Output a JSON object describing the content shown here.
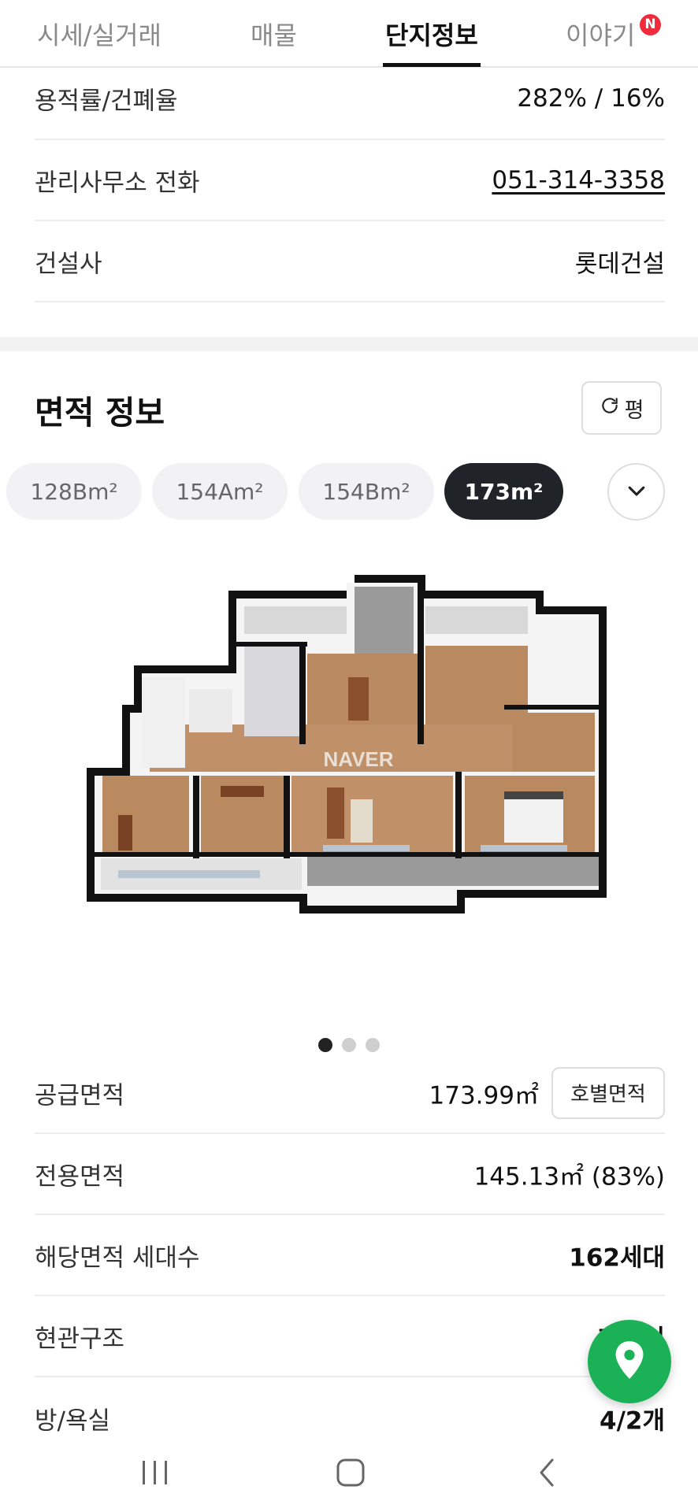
{
  "tabs": [
    {
      "label": "시세/실거래",
      "active": false
    },
    {
      "label": "매물",
      "active": false
    },
    {
      "label": "단지정보",
      "active": true
    },
    {
      "label": "이야기",
      "active": false,
      "badge": "N"
    }
  ],
  "complex_info": {
    "floor_area_ratio": {
      "label": "용적률/건폐율",
      "value": "282% / 16%"
    },
    "office_phone": {
      "label": "관리사무소 전화",
      "value": "051-314-3358"
    },
    "builder": {
      "label": "건설사",
      "value": "롯데건설"
    }
  },
  "area_section": {
    "title": "면적 정보",
    "unit_toggle_label": "평",
    "chips": [
      "128Bm²",
      "154Am²",
      "154Bm²",
      "173m²"
    ],
    "selected_chip": "173m²",
    "floorplan_watermark": "NAVER",
    "carousel": {
      "count": 3,
      "active_index": 0
    },
    "rows": {
      "supply": {
        "label": "공급면적",
        "value": "173.99㎡",
        "button": "호별면적"
      },
      "exclusive": {
        "label": "전용면적",
        "value": "145.13㎡ (83%)"
      },
      "households": {
        "label": "해당면적 세대수",
        "value": "162세대"
      },
      "entrance": {
        "label": "현관구조",
        "value": "계단식"
      },
      "rooms": {
        "label": "방/욕실",
        "value": "4/2개"
      }
    }
  },
  "colors": {
    "accent_green": "#1bb257",
    "badge_red": "#ef2b3c",
    "chip_active": "#202428"
  }
}
